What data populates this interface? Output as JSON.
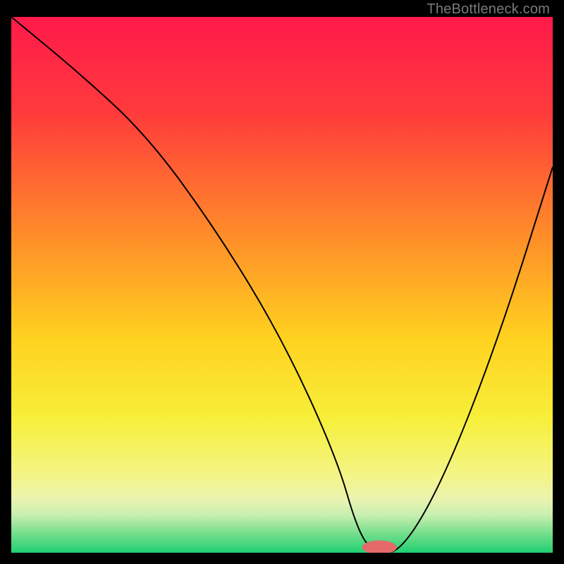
{
  "watermark": "TheBottleneck.com",
  "chart_data": {
    "type": "line",
    "title": "",
    "xlabel": "",
    "ylabel": "",
    "xlim": [
      0,
      100
    ],
    "ylim": [
      0,
      100
    ],
    "grid": false,
    "legend": false,
    "series": [
      {
        "name": "bottleneck-curve",
        "x": [
          0,
          12,
          25,
          38,
          50,
          60,
          64,
          67,
          72,
          80,
          90,
          100
        ],
        "y": [
          100,
          90,
          78,
          60,
          40,
          18,
          4,
          0,
          0,
          14,
          40,
          72
        ]
      }
    ],
    "marker": {
      "name": "optimal-point",
      "x": 68,
      "y": 1,
      "rx": 3.2,
      "ry": 1.3,
      "color": "#e46a6a"
    },
    "gradient_stops": [
      {
        "pct": 0,
        "color": "#ff1a4b"
      },
      {
        "pct": 18,
        "color": "#ff3b3b"
      },
      {
        "pct": 40,
        "color": "#ff8a2a"
      },
      {
        "pct": 60,
        "color": "#ffd21f"
      },
      {
        "pct": 75,
        "color": "#f7ef3a"
      },
      {
        "pct": 86,
        "color": "#f3f58a"
      },
      {
        "pct": 90,
        "color": "#eaf3b0"
      },
      {
        "pct": 93,
        "color": "#c7efb0"
      },
      {
        "pct": 96,
        "color": "#7fe08f"
      },
      {
        "pct": 100,
        "color": "#1fcf72"
      }
    ]
  }
}
